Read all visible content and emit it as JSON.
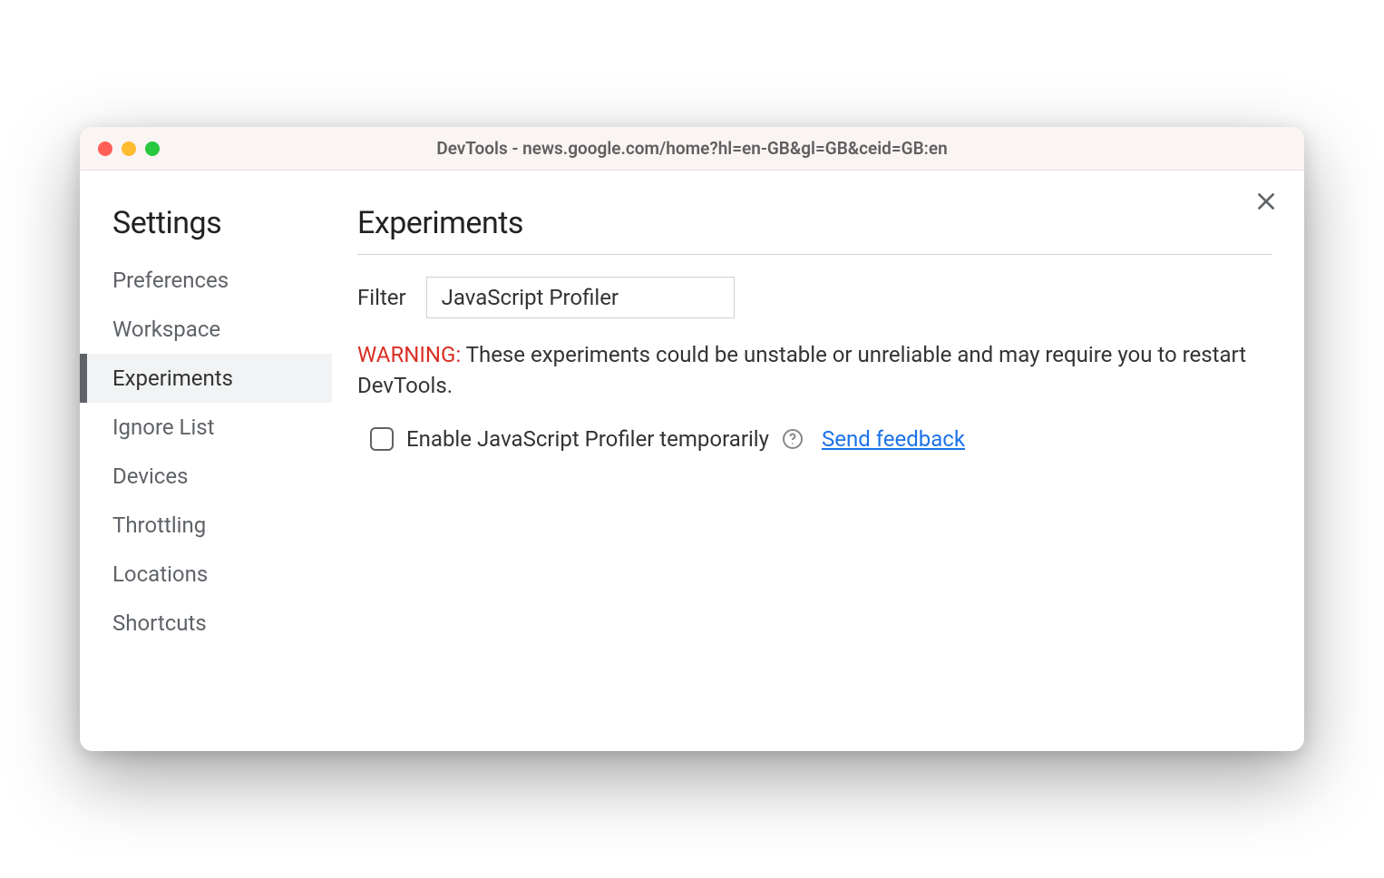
{
  "window": {
    "title": "DevTools - news.google.com/home?hl=en-GB&gl=GB&ceid=GB:en"
  },
  "sidebar": {
    "title": "Settings",
    "items": [
      {
        "label": "Preferences",
        "selected": false
      },
      {
        "label": "Workspace",
        "selected": false
      },
      {
        "label": "Experiments",
        "selected": true
      },
      {
        "label": "Ignore List",
        "selected": false
      },
      {
        "label": "Devices",
        "selected": false
      },
      {
        "label": "Throttling",
        "selected": false
      },
      {
        "label": "Locations",
        "selected": false
      },
      {
        "label": "Shortcuts",
        "selected": false
      }
    ]
  },
  "main": {
    "section_title": "Experiments",
    "filter": {
      "label": "Filter",
      "value": "JavaScript Profiler"
    },
    "warning": {
      "label": "WARNING:",
      "text": " These experiments could be unstable or unreliable and may require you to restart DevTools."
    },
    "experiment": {
      "checked": false,
      "label": "Enable JavaScript Profiler temporarily",
      "feedback_link": "Send feedback"
    }
  }
}
